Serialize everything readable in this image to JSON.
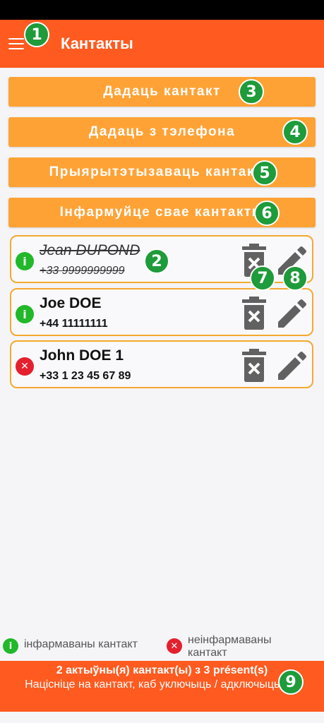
{
  "app": {
    "title": "Кантакты"
  },
  "buttons": {
    "add_contact": "Дадаць кантакт",
    "add_from_phone": "Дадаць з тэлефона",
    "prioritize": "Прыярытэтызаваць кантакты",
    "inform": "Інфармуйце свае кантакты"
  },
  "contacts": [
    {
      "name": "Jean DUPOND",
      "phone": "+33 9999999999",
      "status": "informed",
      "disabled": true
    },
    {
      "name": "Joe DOE",
      "phone": "+44 11111111",
      "status": "informed",
      "disabled": false
    },
    {
      "name": "John DOE 1",
      "phone": "+33 1 23 45 67 89",
      "status": "not-informed",
      "disabled": false
    }
  ],
  "legend": {
    "informed": "інфармаваны кантакт",
    "not_informed": "неінфармаваны кантакт"
  },
  "footer": {
    "summary": "2 актыўны(я) кантакт(ы) з 3 présent(s)",
    "hint": "Націсніце на кантакт, каб уключыць / адключыць яго"
  },
  "markers": [
    "1",
    "2",
    "3",
    "4",
    "5",
    "6",
    "7",
    "8",
    "9"
  ],
  "colors": {
    "appbar": "#ff5a1f",
    "button": "#ffa235",
    "card_border": "#f4a92f",
    "informed": "#21b82a",
    "not_informed": "#e5202e",
    "marker": "#1e9b3a"
  },
  "icons": [
    "menu-icon",
    "info-icon",
    "error-icon",
    "trash-icon",
    "pencil-icon"
  ]
}
